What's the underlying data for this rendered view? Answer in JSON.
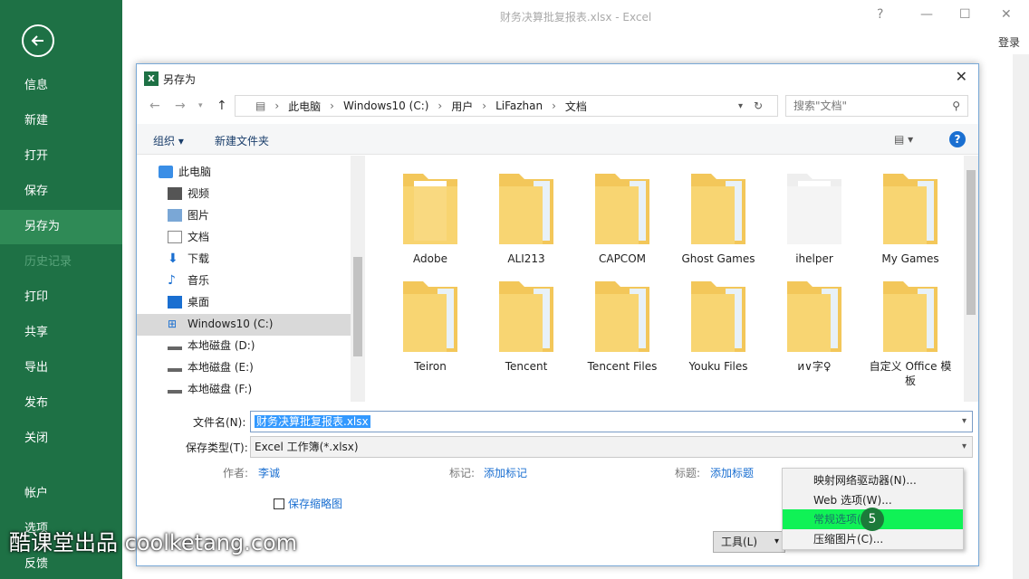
{
  "app": {
    "window_title": "财务决算批复报表.xlsx - Excel",
    "login": "登录",
    "help_glyph": "?",
    "minimize_glyph": "—",
    "restore_glyph": "☐",
    "close_glyph": "✕"
  },
  "sidebar": {
    "items": [
      {
        "label": "信息"
      },
      {
        "label": "新建"
      },
      {
        "label": "打开"
      },
      {
        "label": "保存"
      },
      {
        "label": "另存为"
      },
      {
        "label": "历史记录"
      },
      {
        "label": "打印"
      },
      {
        "label": "共享"
      },
      {
        "label": "导出"
      },
      {
        "label": "发布"
      },
      {
        "label": "关闭"
      },
      {
        "label": "帐户"
      },
      {
        "label": "选项"
      },
      {
        "label": "反馈"
      }
    ],
    "active": "另存为",
    "disabled": "历史记录"
  },
  "dialog": {
    "title": "另存为",
    "breadcrumb": [
      "此电脑",
      "Windows10 (C:)",
      "用户",
      "LiFazhan",
      "文档"
    ],
    "search_placeholder": "搜索\"文档\"",
    "toolbar": {
      "organize": "组织 ▾",
      "new_folder": "新建文件夹",
      "help": "?"
    },
    "tree": [
      {
        "label": "此电脑",
        "icon": "computer-icon"
      },
      {
        "label": "视频",
        "icon": "video-icon"
      },
      {
        "label": "图片",
        "icon": "picture-icon"
      },
      {
        "label": "文档",
        "icon": "document-icon"
      },
      {
        "label": "下载",
        "icon": "download-icon"
      },
      {
        "label": "音乐",
        "icon": "music-icon"
      },
      {
        "label": "桌面",
        "icon": "desktop-icon"
      },
      {
        "label": "Windows10 (C:)",
        "icon": "windows-drive-icon"
      },
      {
        "label": "本地磁盘 (D:)",
        "icon": "drive-icon"
      },
      {
        "label": "本地磁盘 (E:)",
        "icon": "drive-icon"
      },
      {
        "label": "本地磁盘 (F:)",
        "icon": "drive-icon"
      }
    ],
    "selected_tree": "Windows10 (C:)",
    "folders": [
      {
        "name": "Adobe"
      },
      {
        "name": "ALI213"
      },
      {
        "name": "CAPCOM"
      },
      {
        "name": "Ghost Games"
      },
      {
        "name": "ihelper"
      },
      {
        "name": "My Games"
      },
      {
        "name": "Teiron"
      },
      {
        "name": "Tencent"
      },
      {
        "name": "Tencent Files"
      },
      {
        "name": "Youku Files"
      },
      {
        "name": "и∨字♀"
      },
      {
        "name": "自定义 Office 模板"
      }
    ],
    "filename_label": "文件名(N):",
    "filename_value": "财务决算批复报表.xlsx",
    "filetype_label": "保存类型(T):",
    "filetype_value": "Excel 工作簿(*.xlsx)",
    "author_label": "作者:",
    "author_value": "李诚",
    "tags_label": "标记:",
    "tags_value": "添加标记",
    "title_label": "标题:",
    "title_value": "添加标题",
    "thumbnail_label": "保存缩略图",
    "tools_label": "工具(L)",
    "tools_menu": [
      {
        "label": "映射网络驱动器(N)..."
      },
      {
        "label": "Web 选项(W)..."
      },
      {
        "label": "常规选项(G)..."
      },
      {
        "label": "压缩图片(C)..."
      }
    ],
    "highlighted_menu": "常规选项(G)..."
  },
  "overlay": {
    "step_badge": "5",
    "watermark": "酷课堂出品 coolketang.com"
  },
  "colors": {
    "sidebar_bg": "#1e7145",
    "sidebar_active": "#2f8a56",
    "menu_highlight": "#10f256",
    "link": "#1a6fd1"
  }
}
